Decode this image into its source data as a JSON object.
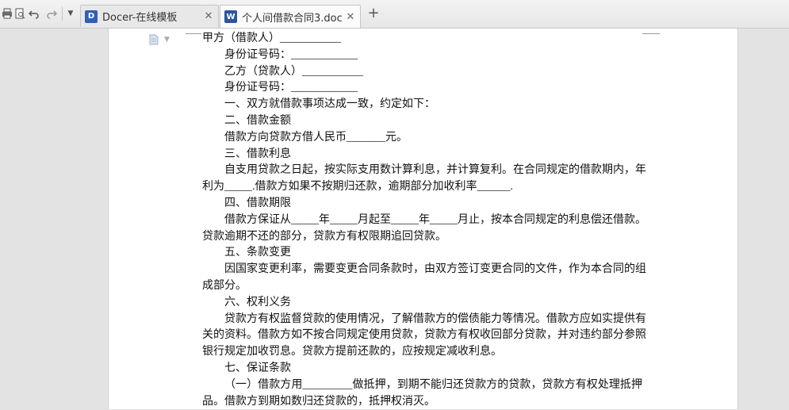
{
  "toolbar": {
    "icons": [
      "print-icon",
      "print-preview-icon",
      "undo-icon",
      "redo-icon",
      "dropdown-icon"
    ]
  },
  "tabs": [
    {
      "label": "Docer-在线模板",
      "icon": "docer-icon",
      "icon_color": "#2f5fb8",
      "icon_glyph": "D",
      "close": "✕",
      "active": false
    },
    {
      "label": "个人间借款合同3.doc",
      "icon": "word-doc-icon",
      "icon_color": "#2b579a",
      "icon_glyph": "W",
      "close": "✕",
      "active": true
    }
  ],
  "new_tab_label": "+",
  "document": {
    "lines": [
      {
        "text": "甲方（借款人）___________",
        "indent": false,
        "justify": false
      },
      {
        "text": "身份证号码：____________",
        "indent": true,
        "justify": false
      },
      {
        "text": "乙方（贷款人）___________",
        "indent": true,
        "justify": false
      },
      {
        "text": "身份证号码：____________",
        "indent": true,
        "justify": false
      },
      {
        "text": "一、双方就借款事项达成一致，约定如下：",
        "indent": true,
        "justify": false
      },
      {
        "text": "二、借款金额",
        "indent": true,
        "justify": false
      },
      {
        "text": "借款方向贷款方借人民币_______元。",
        "indent": true,
        "justify": false
      },
      {
        "text": "三、借款利息",
        "indent": true,
        "justify": false
      },
      {
        "text": "自支用贷款之日起，按实际支用数计算利息，并计算复利。在合同规定的借款期内，年",
        "indent": true,
        "justify": true
      },
      {
        "text": "利为_____.借款方如果不按期归还款，逾期部分加收利率______.",
        "indent": false,
        "justify": false
      },
      {
        "text": "四、借款期限",
        "indent": true,
        "justify": false
      },
      {
        "text": "借款方保证从_____年_____月起至_____年_____月止，按本合同规定的利息偿还借款。",
        "indent": true,
        "justify": true
      },
      {
        "text": "贷款逾期不还的部分，贷款方有权限期追回贷款。",
        "indent": false,
        "justify": false
      },
      {
        "text": "五、条款变更",
        "indent": true,
        "justify": false
      },
      {
        "text": "因国家变更利率，需要变更合同条款时，由双方签订变更合同的文件，作为本合同的组",
        "indent": true,
        "justify": true
      },
      {
        "text": "成部分。",
        "indent": false,
        "justify": false
      },
      {
        "text": "六、权利义务",
        "indent": true,
        "justify": false
      },
      {
        "text": "贷款方有权监督贷款的使用情况，了解借款方的偿债能力等情况。借款方应如实提供有",
        "indent": true,
        "justify": true
      },
      {
        "text": "关的资料。借款方如不按合同规定使用贷款，贷款方有权收回部分贷款，并对违约部分参照",
        "indent": false,
        "justify": true
      },
      {
        "text": "银行规定加收罚息。贷款方提前还款的，应按规定减收利息。",
        "indent": false,
        "justify": false
      },
      {
        "text": "七、保证条款",
        "indent": true,
        "justify": false
      },
      {
        "text": "（一）借款方用_________做抵押，到期不能归还贷款方的贷款，贷款方有权处理抵押",
        "indent": true,
        "justify": true
      },
      {
        "text": "品。借款方到期如数归还贷款的，抵押权消灭。",
        "indent": false,
        "justify": false
      }
    ]
  }
}
